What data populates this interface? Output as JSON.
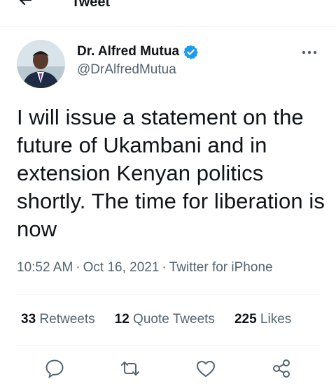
{
  "header": {
    "title": "Tweet"
  },
  "tweet": {
    "author": {
      "name": "Dr. Alfred Mutua",
      "handle": "@DrAlfredMutua",
      "verified": true
    },
    "text": "I will issue a statement on the future of Ukambani and in extension Kenyan politics shortly. The time for liberation is now",
    "time": "10:52 AM",
    "date": "Oct 16, 2021",
    "source": "Twitter for iPhone",
    "stats": {
      "retweets_count": "33",
      "retweets_label": "Retweets",
      "quotes_count": "12",
      "quotes_label": "Quote Tweets",
      "likes_count": "225",
      "likes_label": "Likes"
    }
  },
  "colors": {
    "text": "#0f1419",
    "secondary": "#536471",
    "accent": "#1d9bf0",
    "divider": "#eff3f4"
  },
  "icons": [
    "back-arrow-icon",
    "verified-badge-icon",
    "more-icon",
    "reply-icon",
    "retweet-icon",
    "like-icon",
    "share-icon"
  ]
}
